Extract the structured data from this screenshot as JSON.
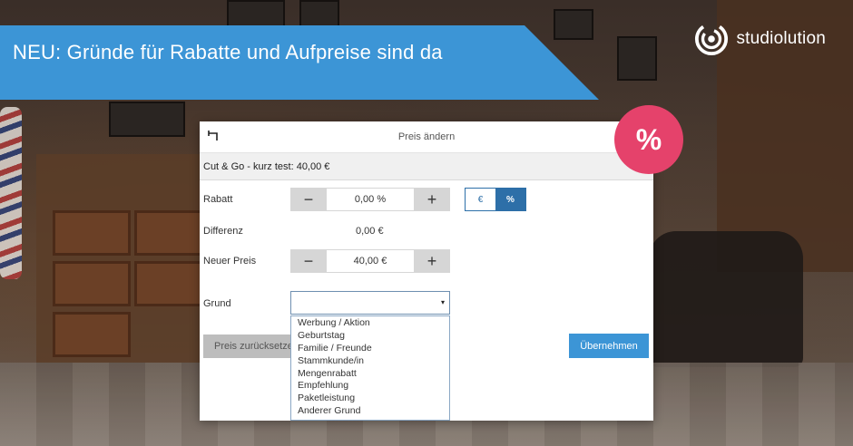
{
  "banner": {
    "text": "NEU: Gründe für Rabatte und Aufpreise sind da"
  },
  "logo": {
    "text": "studiolution",
    "icon": "swirl-logo-icon"
  },
  "badge": {
    "text": "%",
    "color": "#e5426b"
  },
  "colors": {
    "banner_blue": "#3c95d6",
    "toggle_blue": "#2d6fa8",
    "badge_pink": "#e5426b"
  },
  "dialog": {
    "title": "Preis ändern",
    "back_icon": "back-arrow-icon",
    "service": "Cut & Go - kurz test: 40,00 €",
    "rabatt": {
      "label": "Rabatt",
      "value": "0,00 %",
      "minus": "−",
      "plus": "+"
    },
    "unit_toggle": {
      "euro": "€",
      "percent": "%",
      "selected": "%"
    },
    "differenz": {
      "label": "Differenz",
      "value": "0,00 €"
    },
    "neuer_preis": {
      "label": "Neuer Preis",
      "value": "40,00 €",
      "minus": "−",
      "plus": "+"
    },
    "grund": {
      "label": "Grund",
      "value": "",
      "caret": "▾",
      "options": [
        "Werbung / Aktion",
        "Geburtstag",
        "Familie / Freunde",
        "Stammkunde/in",
        "Mengenrabatt",
        "Empfehlung",
        "Paketleistung",
        "Anderer Grund"
      ]
    },
    "reset_label": "Preis zurücksetzen",
    "accept_label": "Übernehmen"
  }
}
